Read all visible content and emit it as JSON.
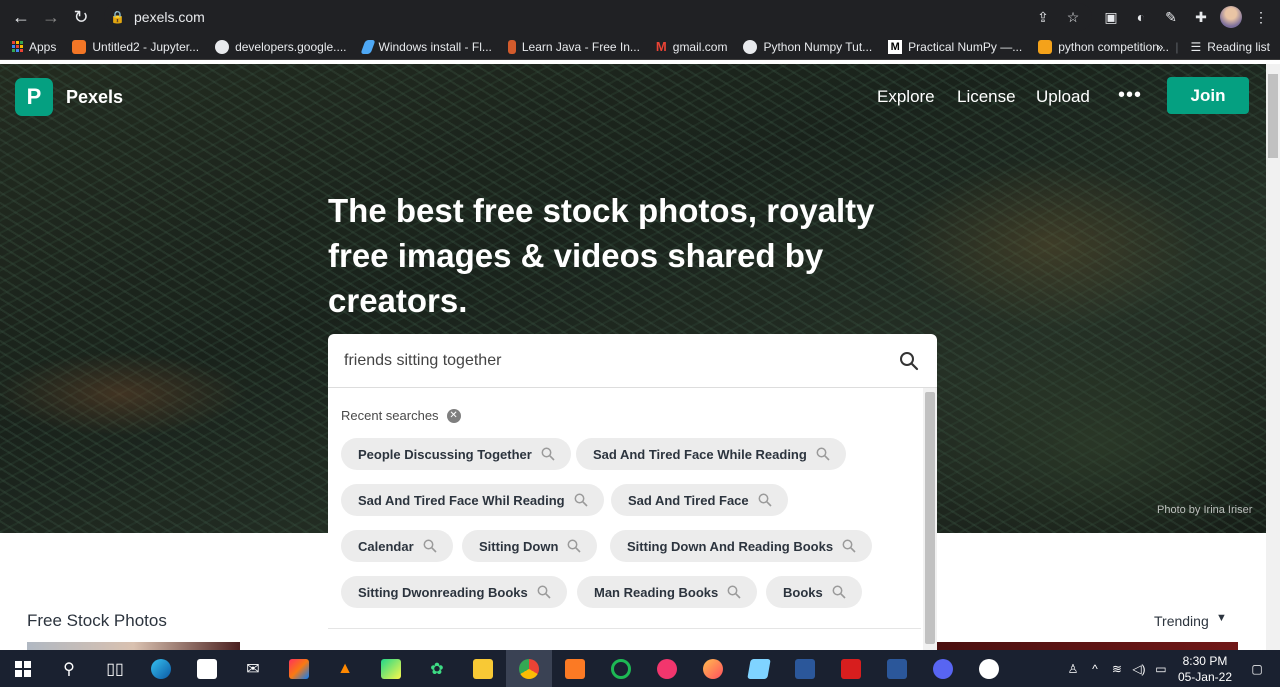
{
  "browser": {
    "url": "pexels.com",
    "bookmarks": [
      {
        "label": "Apps",
        "color": "#e8eaed"
      },
      {
        "label": "Untitled2 - Jupyter...",
        "color": "#f37626"
      },
      {
        "label": "developers.google....",
        "color": "#e8eaed"
      },
      {
        "label": "Windows install - Fl...",
        "color": "#4ea8f5"
      },
      {
        "label": "Learn Java - Free In...",
        "color": "#d35b2c"
      },
      {
        "label": "gmail.com",
        "color": "#ea4335"
      },
      {
        "label": "Python Numpy Tut...",
        "color": "#e8eaed"
      },
      {
        "label": "Practical NumPy —...",
        "color": "#ffffff"
      },
      {
        "label": "python competition...",
        "color": "#f4a21a"
      }
    ],
    "more_bookmarks": "»",
    "reading_list": "Reading list"
  },
  "header": {
    "brand": "Pexels",
    "logo_letter": "P",
    "nav": [
      "Explore",
      "License",
      "Upload"
    ],
    "more": "•••",
    "join": "Join"
  },
  "hero": {
    "headline": "The best free stock photos, royalty free images & videos shared by creators.",
    "credit": "Photo by Irina Iriser"
  },
  "search": {
    "value": "friends sitting together",
    "recent_label": "Recent searches",
    "recent": [
      "People Discussing Together",
      "Sad And Tired Face While Reading",
      "Sad And Tired Face Whil Reading",
      "Sad And Tired Face",
      "Calendar",
      "Sitting Down",
      "Sitting Down And Reading Books",
      "Sitting Dwonreading Books",
      "Man Reading Books",
      "Books"
    ]
  },
  "main": {
    "section_title": "Free Stock Photos",
    "sort": "Trending"
  },
  "taskbar": {
    "time": "8:30 PM",
    "date": "05-Jan-22"
  },
  "colors": {
    "accent": "#05a081",
    "chip_bg": "#ececec",
    "text_dark": "#2c343e"
  }
}
